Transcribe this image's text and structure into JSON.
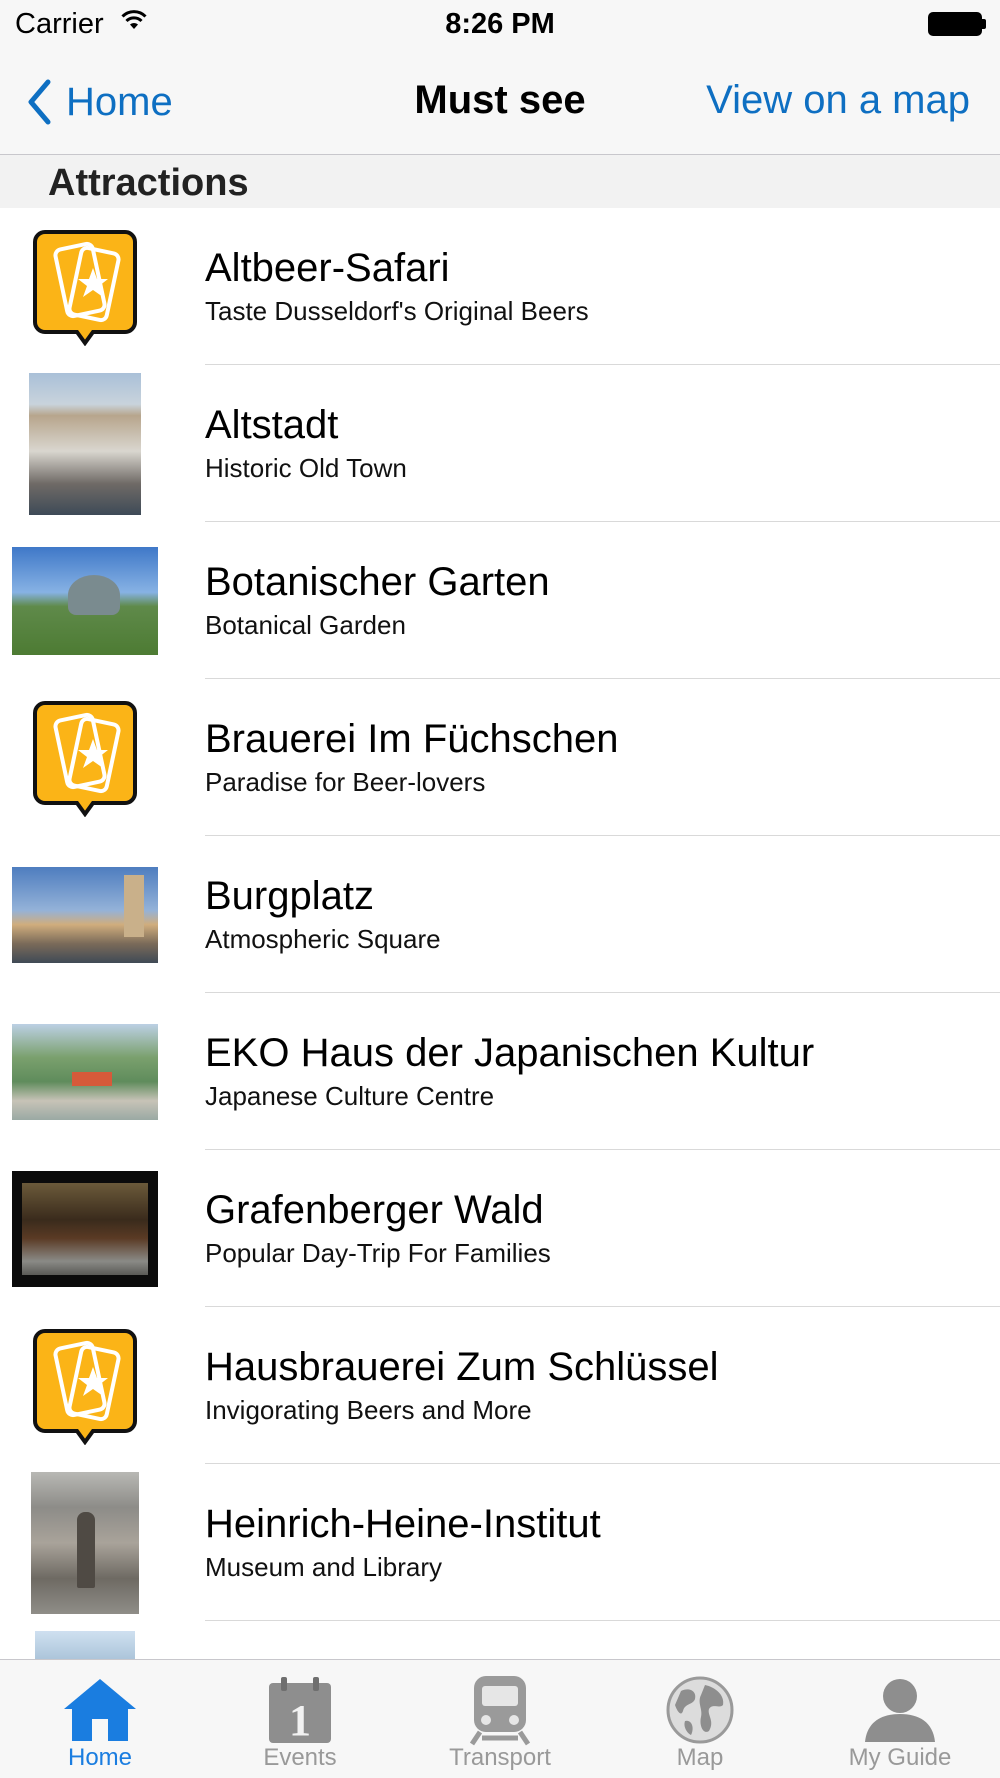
{
  "status_bar": {
    "carrier": "Carrier",
    "time": "8:26 PM"
  },
  "nav": {
    "back_label": "Home",
    "title": "Must see",
    "right_action": "View on a map"
  },
  "section": {
    "header": "Attractions"
  },
  "items": [
    {
      "title": "Altbeer-Safari",
      "subtitle": "Taste Dusseldorf's Original Beers",
      "thumb": "ticket-star-icon"
    },
    {
      "title": "Altstadt",
      "subtitle": "Historic Old Town",
      "thumb": "photo-altstadt"
    },
    {
      "title": "Botanischer Garten",
      "subtitle": "Botanical Garden",
      "thumb": "photo-botanic"
    },
    {
      "title": "Brauerei Im Füchschen",
      "subtitle": "Paradise for Beer-lovers",
      "thumb": "ticket-star-icon"
    },
    {
      "title": "Burgplatz",
      "subtitle": "Atmospheric Square",
      "thumb": "photo-burg"
    },
    {
      "title": "EKO Haus der Japanischen Kultur",
      "subtitle": "Japanese Culture Centre",
      "thumb": "photo-eko"
    },
    {
      "title": "Grafenberger Wald",
      "subtitle": "Popular Day-Trip For Families",
      "thumb": "photo-wald"
    },
    {
      "title": "Hausbrauerei Zum Schlüssel",
      "subtitle": "Invigorating Beers and More",
      "thumb": "ticket-star-icon"
    },
    {
      "title": "Heinrich-Heine-Institut",
      "subtitle": "Museum and Library",
      "thumb": "photo-heine"
    },
    {
      "title": "",
      "subtitle": "",
      "thumb": "photo-partial"
    }
  ],
  "tabs": [
    {
      "label": "Home",
      "icon": "home-icon",
      "active": true
    },
    {
      "label": "Events",
      "icon": "calendar-icon",
      "active": false
    },
    {
      "label": "Transport",
      "icon": "train-icon",
      "active": false
    },
    {
      "label": "Map",
      "icon": "globe-icon",
      "active": false
    },
    {
      "label": "My Guide",
      "icon": "person-icon",
      "active": false
    }
  ],
  "colors": {
    "accent": "#0e6fc2",
    "tab_active": "#1a7de0",
    "tab_inactive": "#999999",
    "ticket_icon_fill": "#fbb417"
  }
}
